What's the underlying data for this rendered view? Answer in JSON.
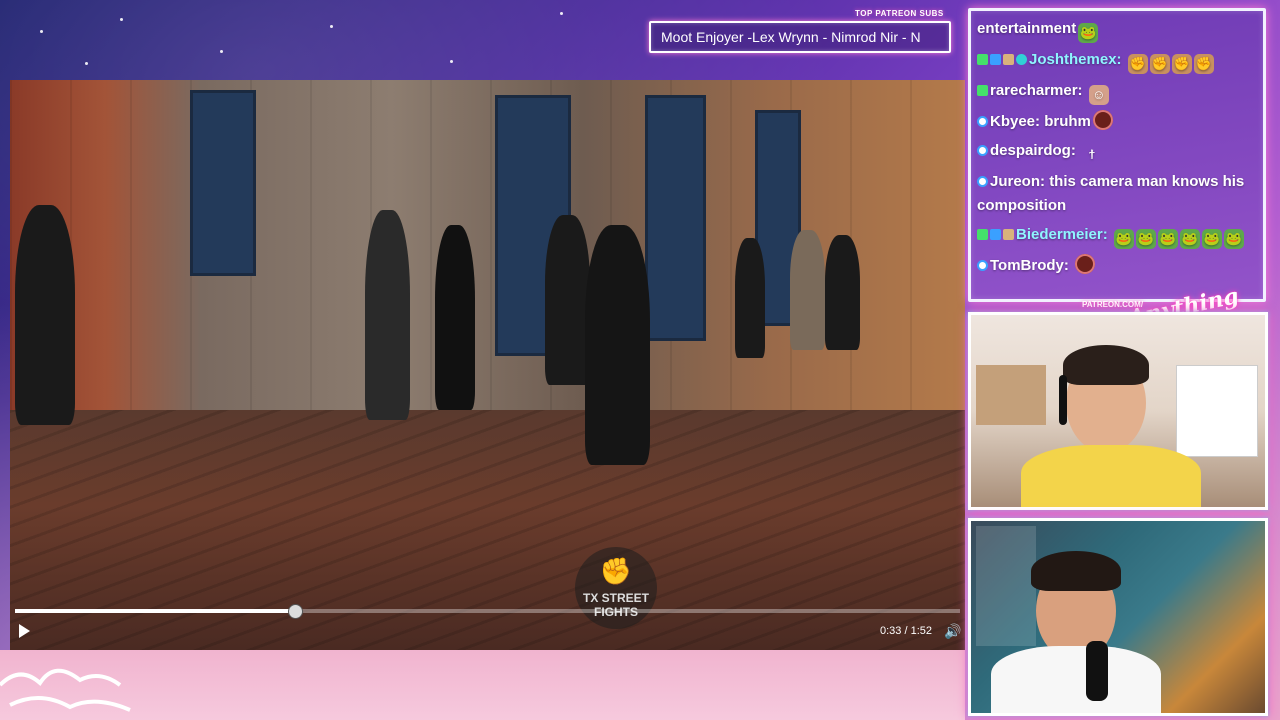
{
  "ticker": {
    "label": "TOP PATREON SUBS",
    "text": "Moot Enjoyer -Lex Wrynn - Nimrod Nir - N"
  },
  "video": {
    "watermark_line1": "TX STREET",
    "watermark_line2": "FIGHTS",
    "time": "0:33 / 1:52",
    "progress": 0.295
  },
  "chat": {
    "lines": [
      {
        "user": "",
        "text": "entertainment",
        "badges": [],
        "emotes": [
          "frog"
        ]
      },
      {
        "user": "Joshthemex",
        "text": "",
        "badges": [
          "green",
          "blue",
          "tan",
          "cyan"
        ],
        "emotes": [
          "hand",
          "hand",
          "hand",
          "hand"
        ]
      },
      {
        "user": "rarecharmer",
        "text": "",
        "badges": [
          "green"
        ],
        "emotes": [
          "face"
        ]
      },
      {
        "user": "Kbyee",
        "text": "bruhm",
        "badges": [
          "ring"
        ],
        "emotes": [
          "nut"
        ]
      },
      {
        "user": "despairdog",
        "text": "",
        "badges": [
          "ring"
        ],
        "emotes": [
          "stick"
        ]
      },
      {
        "user": "Jureon",
        "text": "this camera man knows his composition",
        "badges": [
          "ring"
        ],
        "emotes": []
      },
      {
        "user": "Biedermeier",
        "text": "",
        "badges": [
          "green",
          "blue",
          "tan"
        ],
        "emotes": [
          "frog",
          "frog",
          "frog",
          "frog",
          "frog",
          "frog"
        ]
      },
      {
        "user": "TomBrody",
        "text": "",
        "badges": [
          "ring"
        ],
        "emotes": [
          "nut"
        ]
      }
    ]
  },
  "branding": {
    "patreon": "PATREON.COM/",
    "logo": "AnythingElse"
  },
  "colors": {
    "accent": "#ff5fbf",
    "chat_bg": "#7c4ac0",
    "user_name": "#8ff5ff",
    "user_name_alt": "#ffffff"
  }
}
